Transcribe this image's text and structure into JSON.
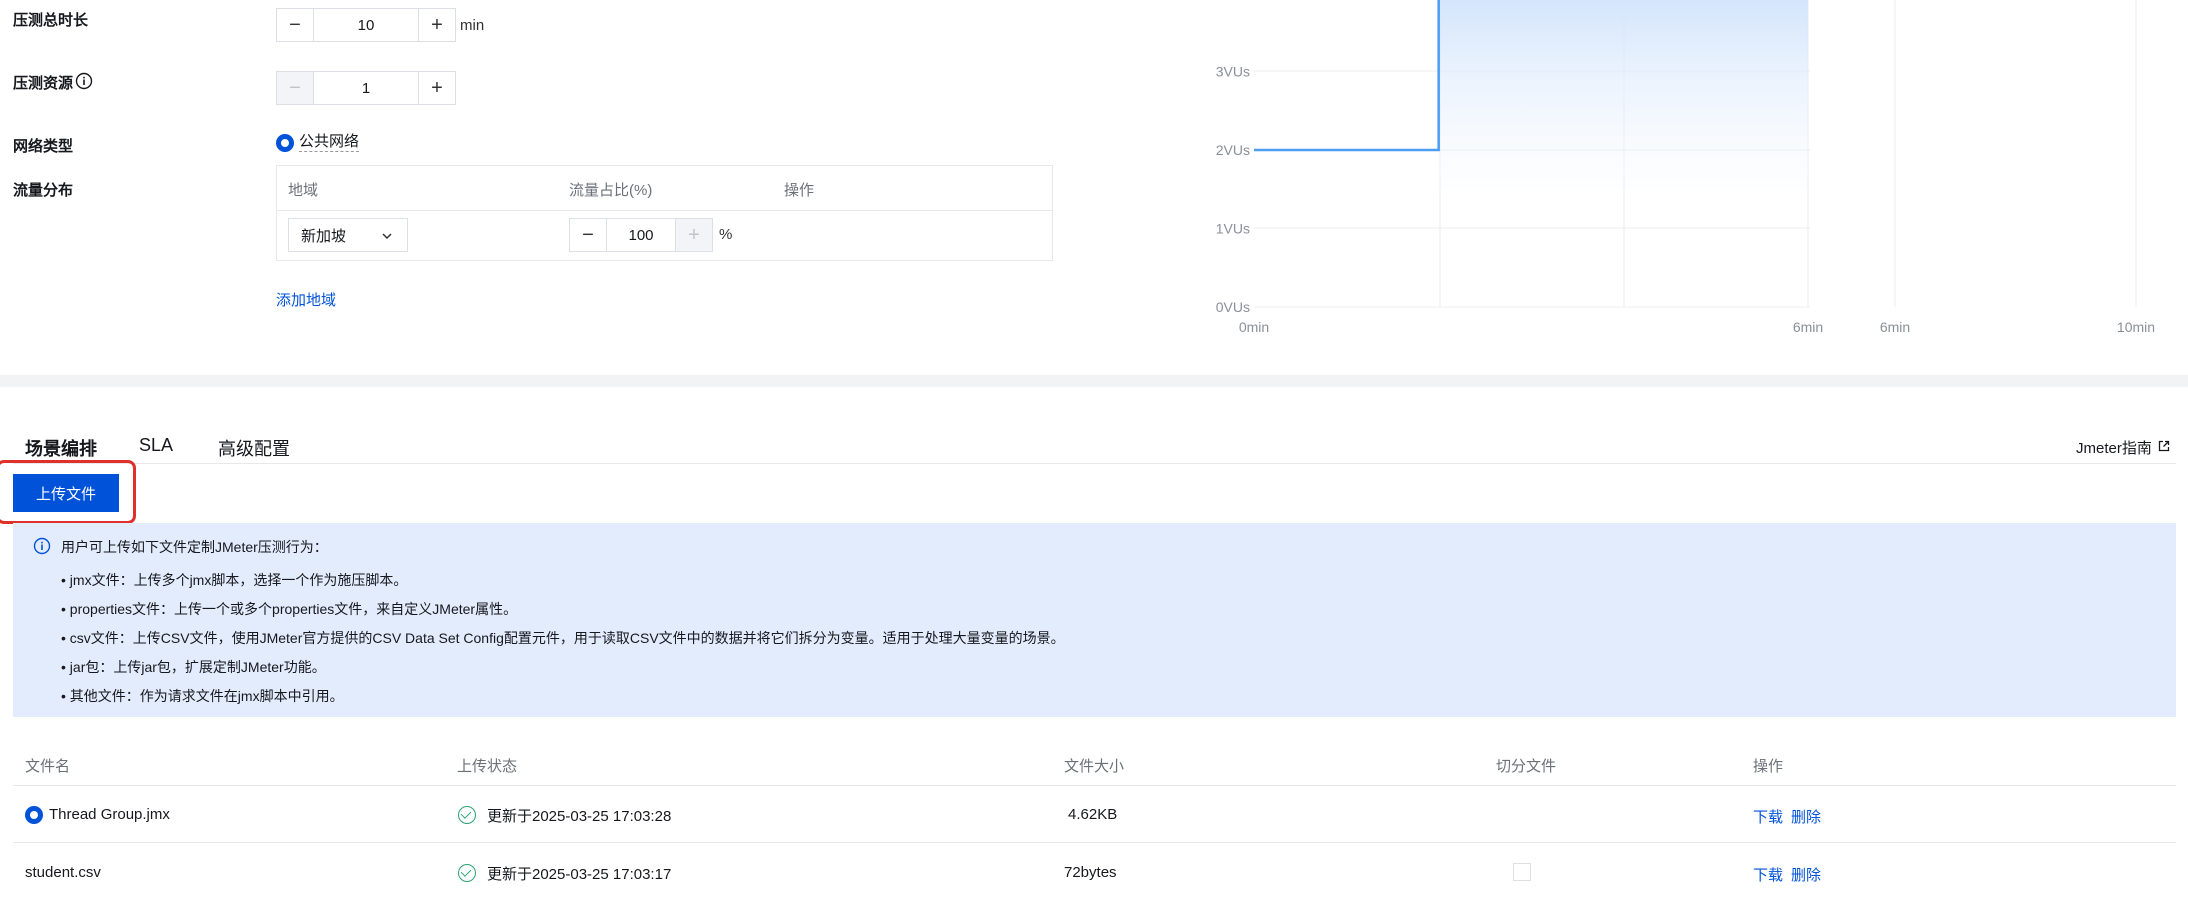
{
  "form": {
    "duration_label": "压测总时长",
    "duration_value": "10",
    "duration_unit": "min",
    "resource_label": "压测资源",
    "resource_value": "1",
    "network_label": "网络类型",
    "network_option": "公共网络",
    "traffic_label": "流量分布",
    "traffic_table": {
      "headers": [
        "地域",
        "流量占比(%)",
        "操作"
      ],
      "region": "新加坡",
      "ratio": "100",
      "ratio_unit": "%"
    },
    "add_region": "添加地域",
    "minus": "−",
    "plus": "+"
  },
  "chart_data": {
    "type": "line",
    "ylabel_ticks": [
      "0VUs",
      "1VUs",
      "2VUs",
      "3VUs"
    ],
    "xlabel_ticks_left": [
      "0min",
      "6min"
    ],
    "xlabel_ticks_right": [
      "6min",
      "10min"
    ],
    "series": [
      {
        "points": [
          [
            0,
            2
          ],
          [
            2,
            2
          ],
          [
            2,
            4
          ],
          [
            6,
            4
          ]
        ]
      }
    ],
    "ylim": [
      0,
      4
    ],
    "xlim": [
      0,
      6
    ],
    "accent": "#4a9cf5"
  },
  "tabs": {
    "items": [
      "场景编排",
      "SLA",
      "高级配置"
    ],
    "active": 0,
    "guide_link": "Jmeter指南"
  },
  "upload": {
    "button": "上传文件"
  },
  "notice": {
    "title": "用户可上传如下文件定制JMeter压测行为：",
    "items": [
      "jmx文件：上传多个jmx脚本，选择一个作为施压脚本。",
      "properties文件：上传一个或多个properties文件，来自定义JMeter属性。",
      "csv文件：上传CSV文件，使用JMeter官方提供的CSV Data Set Config配置元件，用于读取CSV文件中的数据并将它们拆分为变量。适用于处理大量变量的场景。",
      "jar包：上传jar包，扩展定制JMeter功能。",
      "其他文件：作为请求文件在jmx脚本中引用。"
    ]
  },
  "files": {
    "headers": [
      "文件名",
      "上传状态",
      "文件大小",
      "切分文件",
      "操作"
    ],
    "rows": [
      {
        "name": "Thread Group.jmx",
        "status": "更新于2025-03-25 17:03:28",
        "size": "4.62KB",
        "download": "下载",
        "delete": "删除"
      },
      {
        "name": "student.csv",
        "status": "更新于2025-03-25 17:03:17",
        "size": "72bytes",
        "download": "下载",
        "delete": "删除"
      }
    ]
  }
}
